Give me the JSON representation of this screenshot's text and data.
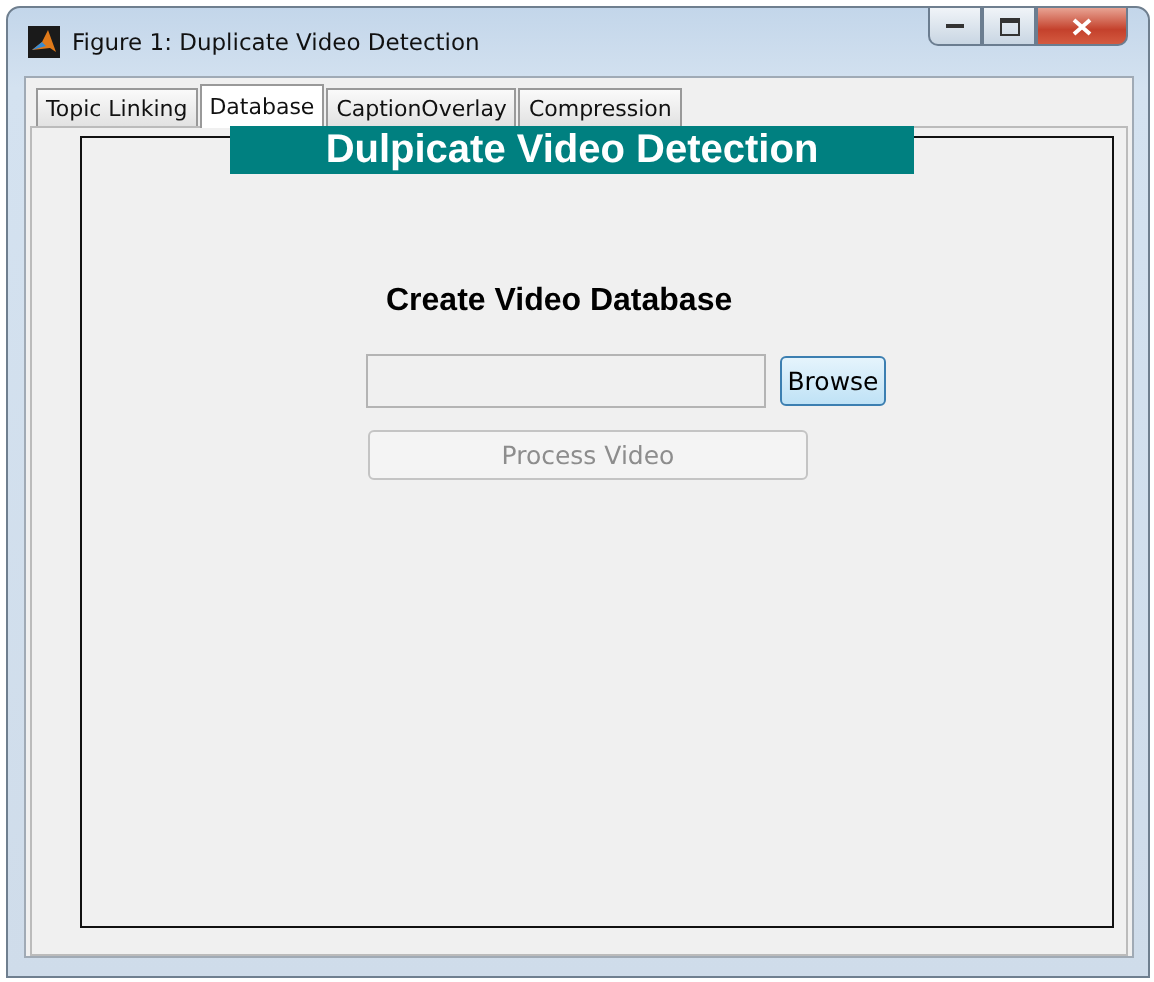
{
  "window": {
    "title": "Figure 1: Duplicate Video Detection"
  },
  "tabs": [
    {
      "label": "Topic Linking",
      "selected": false
    },
    {
      "label": "Database",
      "selected": true
    },
    {
      "label": "CaptionOverlay",
      "selected": false
    },
    {
      "label": "Compression",
      "selected": false
    }
  ],
  "banner": {
    "text": "Dulpicate Video Detection"
  },
  "panel": {
    "heading": "Create Video Database",
    "buttons": [
      {
        "label": "Browse",
        "disabled": false
      },
      {
        "label": "Process Video",
        "disabled": true
      }
    ]
  }
}
